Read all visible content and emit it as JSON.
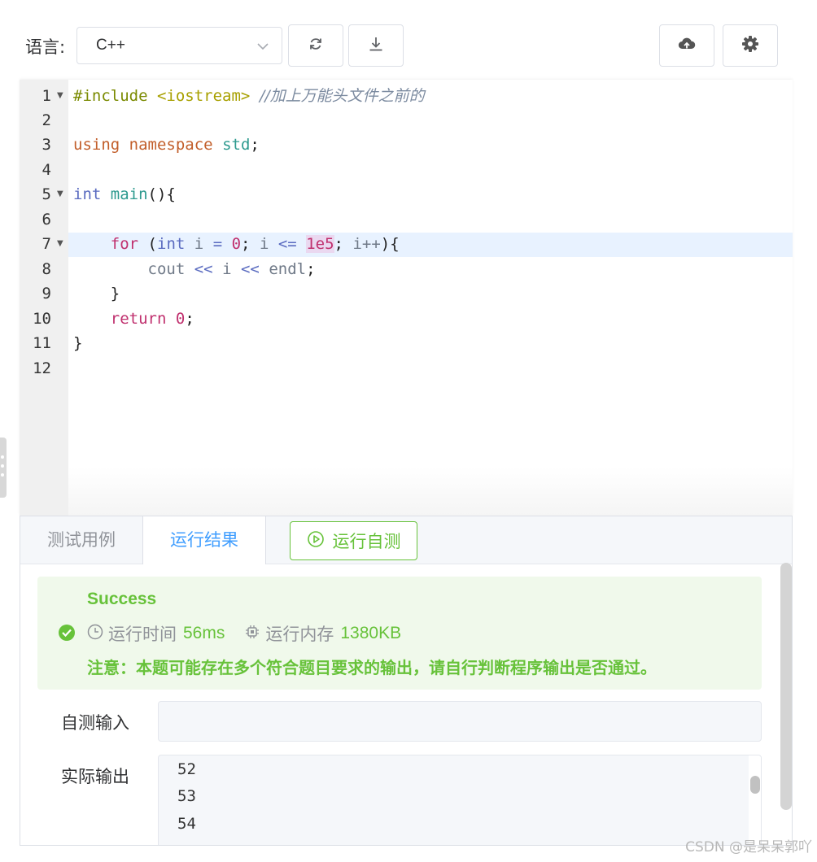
{
  "toolbar": {
    "language_label": "语言:",
    "language_value": "C++",
    "icons": [
      "refresh-icon",
      "download-icon",
      "upload-cloud-icon",
      "gear-icon"
    ]
  },
  "editor": {
    "line_numbers": [
      "1",
      "2",
      "3",
      "4",
      "5",
      "6",
      "7",
      "8",
      "9",
      "10",
      "11",
      "12"
    ],
    "code": {
      "l1_include": "#include",
      "l1_header": "<iostream>",
      "l1_comment": "//加上万能头文件之前的",
      "l3_using": "using",
      "l3_namespace": "namespace",
      "l3_std": "std",
      "l3_semi": ";",
      "l5_int": "int",
      "l5_main": "main",
      "l5_rest": "(){",
      "l7_for": "for",
      "l7_paren": "(",
      "l7_int": "int",
      "l7_i": "i",
      "l7_eq": "=",
      "l7_zero": "0",
      "l7_semi1": ";",
      "l7_i2": "i",
      "l7_le": "<=",
      "l7_1e5": "1e5",
      "l7_semi2": ";",
      "l7_inc": "i++",
      "l7_close": "){",
      "l8_cout": "cout",
      "l8_shl1": "<<",
      "l8_i": "i",
      "l8_shl2": "<<",
      "l8_endl": "endl",
      "l8_semi": ";",
      "l9_brace": "}",
      "l10_return": "return",
      "l10_zero": "0",
      "l10_semi": ";",
      "l11_brace": "}"
    }
  },
  "panel": {
    "tabs": {
      "test_cases": "测试用例",
      "run_result": "运行结果"
    },
    "run_button": "运行自测",
    "result": {
      "status": "Success",
      "time_label": "运行时间",
      "time_value": "56ms",
      "memory_label": "运行内存",
      "memory_value": "1380KB",
      "note": "注意：本题可能存在多个符合题目要求的输出，请自行判断程序输出是否通过。"
    },
    "self_input_label": "自测输入",
    "self_input_value": "",
    "actual_output_label": "实际输出",
    "actual_output_lines": [
      "52",
      "53",
      "54"
    ]
  },
  "watermark": "CSDN @是呆呆郭吖",
  "colors": {
    "success": "#67c23a",
    "success_bg": "#f0f9eb",
    "accent": "#409eff",
    "active_line": "#e8f2ff"
  }
}
